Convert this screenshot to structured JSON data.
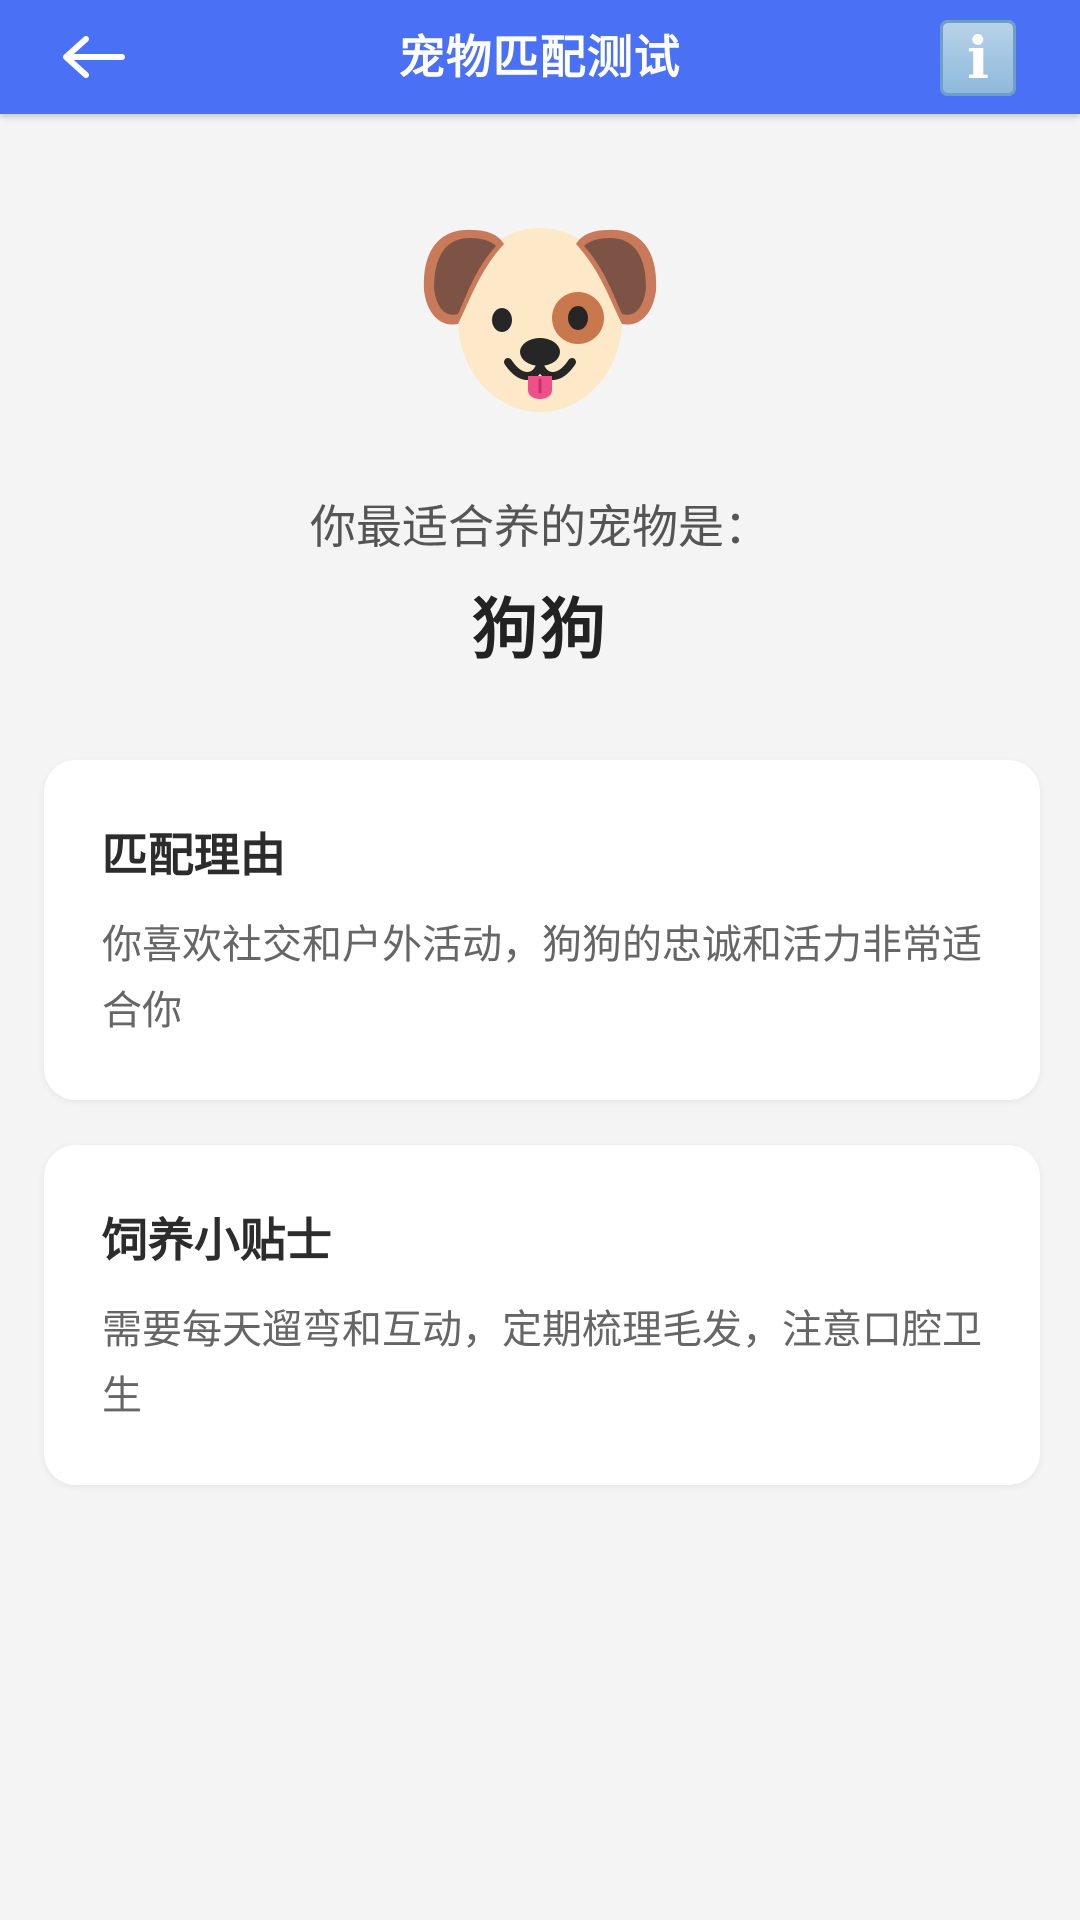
{
  "header": {
    "title": "宠物匹配测试",
    "back_icon": "arrow-left-icon",
    "info_icon": "info-icon",
    "info_glyph": "i",
    "color": "#4a70f6"
  },
  "result": {
    "pet_icon": "dog-face-icon",
    "prompt": "你最适合养的宠物是：",
    "pet_name": "狗狗"
  },
  "cards": [
    {
      "title": "匹配理由",
      "body": "你喜欢社交和户外活动，狗狗的忠诚和活力非常适合你"
    },
    {
      "title": "饲养小贴士",
      "body": "需要每天遛弯和互动，定期梳理毛发，注意口腔卫生"
    }
  ]
}
